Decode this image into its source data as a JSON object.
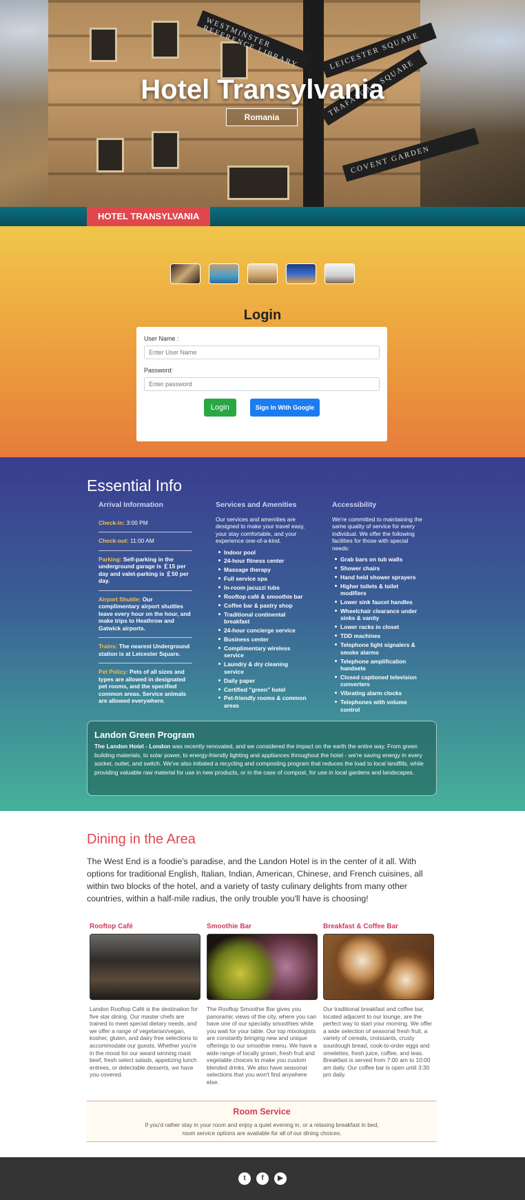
{
  "hero": {
    "title": "Hotel Transylvania",
    "badge": "Romania",
    "signs": [
      "WESTMINSTER REFERENCE LIBRARY",
      "LEICESTER SQUARE",
      "TRAFALGAR SQUARE",
      "COVENT GARDEN"
    ]
  },
  "nav": {
    "brand": "HOTEL TRANSYLVANIA"
  },
  "login": {
    "title": "Login",
    "username_label": "User Name :",
    "username_placeholder": "Enter User Name",
    "password_label": "Password:",
    "password_placeholder": "Enter password",
    "login_button": "Login",
    "google_button": "Sign In With Google"
  },
  "info": {
    "title": "Essential Info",
    "arrival": {
      "heading": "Arrival Information",
      "items": [
        {
          "label": "Check-in:",
          "text": " 3:00 PM"
        },
        {
          "label": "Check-out:",
          "text": " 11:00 AM"
        },
        {
          "label": "Parking:",
          "text": " Self-parking in the underground garage is ￡15 per day and valet-parking is ￡50 per day."
        },
        {
          "label": "Airport Shuttle:",
          "text": " Our complimentary airport shuttles leave every hour on the hour, and make trips to Heathrow and Gatwick airports."
        },
        {
          "label": "Trains:",
          "text": " The nearest Underground station is at Leicester Square."
        },
        {
          "label": "Pet Policy:",
          "text": " Pets of all sizes and types are allowed in designated pet rooms, and the specified common areas. Service animals are allowed everywhere."
        }
      ]
    },
    "services": {
      "heading": "Services and Amenities",
      "intro": "Our services and amenities are designed to make your travel easy, your stay comfortable, and your experience one-of-a-kind.",
      "items": [
        "Indoor pool",
        "24-hour fitness center",
        "Massage therapy",
        "Full service spa",
        "In-room jacuzzi tubs",
        "Rooftop café & smoothie bar",
        "Coffee bar & pastry shop",
        "Traditional continental breakfast",
        "24-hour concierge service",
        "Business center",
        "Complimentary wireless service",
        "Laundry & dry cleaning service",
        "Daily paper",
        "Certified \"green\" hotel",
        "Pet-friendly rooms & common areas"
      ]
    },
    "accessibility": {
      "heading": "Accessibility",
      "intro": "We're committed to maintaining the same quality of service for every individual. We offer the following facilities for those with special needs:",
      "items": [
        "Grab bars on tub walls",
        "Shower chairs",
        "Hand held shower sprayers",
        "Higher toilets & toilet modifiers",
        "Lower sink faucet handles",
        "Wheelchair clearance under sinks & vanity",
        "Lower racks in closet",
        "TDD machines",
        "Telephone light signalers & smoke alarms",
        "Telephone amplification handsets",
        "Closed captioned television converters",
        "Vibrating alarm clocks",
        "Telephones with volume control"
      ]
    },
    "green": {
      "title": "Landon Green Program",
      "lead": "The Landon Hotel - London",
      "text": " was recently renovated, and we considered the impact on the earth the entire way. From green building materials, to solar power, to energy-friendly lighting and appliances throughout the hotel - we're saving energy in every socket, outlet, and switch. We've also initiated a recycling and composting program that reduces the load to local landfills, while providing valuable raw material for use in new products, or in the case of compost, for use in local gardens and landscapes."
    }
  },
  "dining": {
    "title": "Dining in the Area",
    "intro": "The West End is a foodie's paradise, and the Landon Hotel is in the center of it all. With options for traditional English, Italian, Indian, American, Chinese, and French cuisines, all within two blocks of the hotel, and a variety of tasty culinary delights from many other countries, within a half-mile radius, the only trouble you'll have is choosing!",
    "venues": [
      {
        "name": "Rooftop Café",
        "text": "Landon Rooftop Café is the destination for five star dining. Our master chefs are trained to meet special dietary needs, and we offer a range of vegetarian/vegan, kosher, gluten, and dairy free selections to accommodate our guests. Whether you're in the mood for our award winning roast beef, fresh select salads, appetizing lunch entrees, or delectable desserts, we have you covered."
      },
      {
        "name": "Smoothie Bar",
        "text": "The Rooftop Smoothie Bar gives you panoramic views of the city, where you can have one of our specialty smoothies while you wait for your table. Our top mixologists are constantly bringing new and unique offerings to our smoothie menu. We have a wide range of locally grown, fresh fruit and vegetable choices to make you custom blended drinks. We also have seasonal selections that you won't find anywhere else."
      },
      {
        "name": "Breakfast & Coffee Bar",
        "text": "Our traditional breakfast and coffee bar, located adjacent to our lounge, are the perfect way to start your morning. We offer a wide selection of seasonal fresh fruit, a variety of cereals, croissants, crusty sourdough bread, cook-to-order eggs and omelettes, fresh juice, coffee, and teas. Breakfast is served from 7:00 am to 10:00 am daily. Our coffee bar is open until 3:30 pm daily."
      }
    ],
    "room_service": {
      "title": "Room Service",
      "line1": "If you'd rather stay in your room and enjoy a quiet evening in, or a relaxing breakfast in bed,",
      "line2": "room service options are available for all of our dining choices."
    }
  },
  "footer": {
    "icons": [
      "twitter-icon",
      "facebook-icon",
      "youtube-icon"
    ],
    "glyphs": [
      "t",
      "f",
      "▶"
    ]
  }
}
